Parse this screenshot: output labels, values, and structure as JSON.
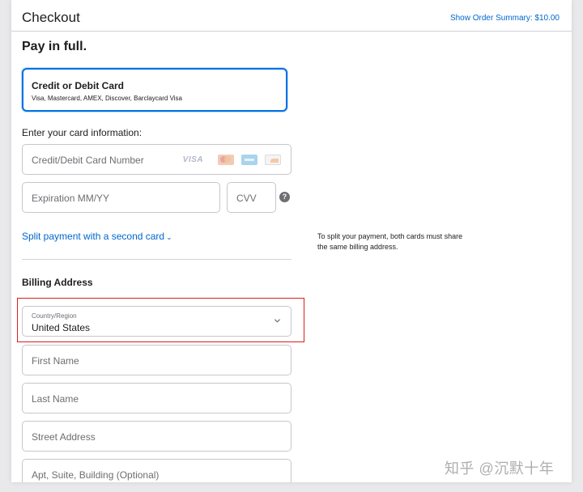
{
  "header": {
    "title": "Checkout",
    "order_summary_link": "Show Order Summary: $10.00"
  },
  "payment": {
    "section_title": "Pay in full.",
    "option": {
      "title": "Credit or Debit Card",
      "description": "Visa, Mastercard, AMEX, Discover, Barclaycard Visa"
    },
    "card_info_label": "Enter your card information:",
    "card_number_placeholder": "Credit/Debit Card Number",
    "card_logos": {
      "visa": "VISA"
    },
    "expiration_placeholder": "Expiration MM/YY",
    "cvv_placeholder": "CVV",
    "cvv_help_icon": "?",
    "split_link": "Split payment with a second card",
    "split_chevron": "⌄",
    "split_note": "To split your payment, both cards must share the same billing address."
  },
  "billing": {
    "title": "Billing Address",
    "country_label": "Country/Region",
    "country_value": "United States",
    "first_name_placeholder": "First Name",
    "last_name_placeholder": "Last Name",
    "street_placeholder": "Street Address",
    "apt_placeholder": "Apt, Suite, Building (Optional)"
  },
  "watermark": "知乎 @沉默十年",
  "colors": {
    "accent": "#0071e3",
    "link": "#0066cc",
    "highlight": "#d81e1e"
  }
}
